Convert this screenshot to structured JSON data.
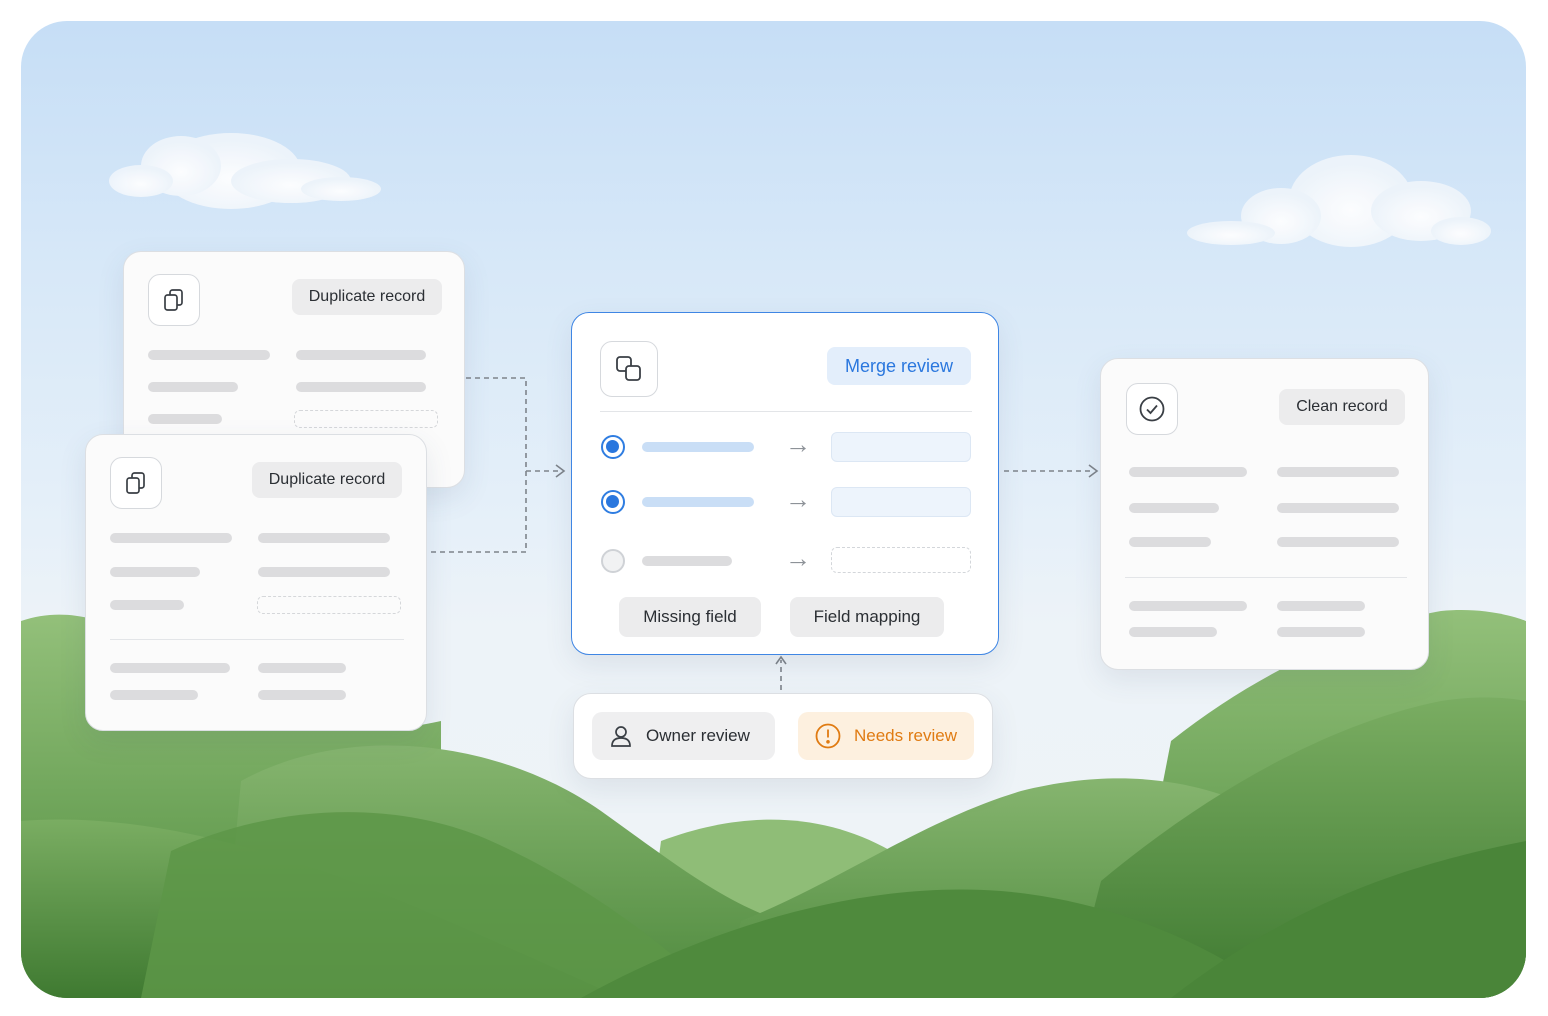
{
  "cards": {
    "duplicate_back": {
      "label": "Duplicate record"
    },
    "duplicate_front": {
      "label": "Duplicate record"
    },
    "merge": {
      "label": "Merge review",
      "missing_field": "Missing field",
      "field_mapping": "Field mapping"
    },
    "clean": {
      "label": "Clean record"
    },
    "review": {
      "owner": "Owner review",
      "needs": "Needs review"
    }
  },
  "colors": {
    "accent_blue": "#2a77de",
    "merge_border": "#3f86e4",
    "warning_orange": "#e07b12",
    "warning_bg": "#fdf0df",
    "grass": "#5f9a4c"
  },
  "icons": {
    "duplicate": "copy-icon",
    "merge": "merge-icon",
    "clean": "check-circle-icon",
    "owner": "user-icon",
    "needs": "alert-circle-icon"
  }
}
